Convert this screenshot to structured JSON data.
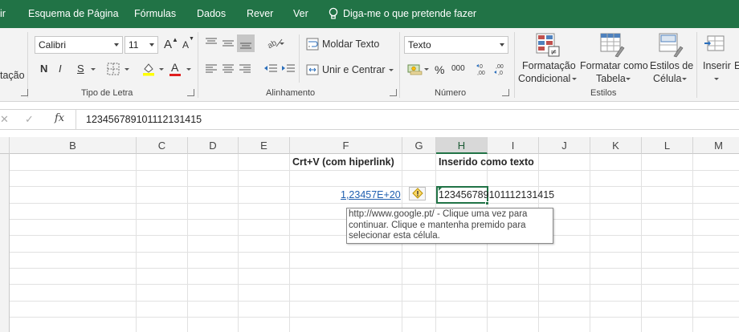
{
  "menu": {
    "items": [
      "ir",
      "Esquema de Página",
      "Fórmulas",
      "Dados",
      "Rever",
      "Ver"
    ],
    "tell_me": "Diga-me o que pretende fazer"
  },
  "ribbon": {
    "partial_left_label": "tação",
    "font_name": "Calibri",
    "font_size": "11",
    "grow_label": "A",
    "shrink_label": "A",
    "bold_label": "N",
    "italic_label": "I",
    "underline_label": "S",
    "font_color_label": "A",
    "font_group_label": "Tipo de Letra",
    "wrap_text_label": "Moldar Texto",
    "merge_center_label": "Unir e Centrar",
    "alignment_group_label": "Alinhamento",
    "number_format": "Texto",
    "percent_label": "%",
    "thousands_label": "000",
    "number_group_label": "Número",
    "conditional_format_line1": "Formatação",
    "conditional_format_line2": "Condicional",
    "format_table_line1": "Formatar como",
    "format_table_line2": "Tabela",
    "cell_styles_line1": "Estilos de",
    "cell_styles_line2": "Célula",
    "styles_group_label": "Estilos",
    "insert_label": "Inserir",
    "partial_right_label": "E"
  },
  "formula_bar": {
    "fx_label": "fx",
    "content": "123456789101112131415"
  },
  "columns": [
    "B",
    "C",
    "D",
    "E",
    "F",
    "G",
    "H",
    "I",
    "J",
    "K",
    "L",
    "M"
  ],
  "cells": {
    "f_header": "Crt+V (com hiperlink)",
    "h_header": "Inserido como texto",
    "f_value": "1,23457E+20",
    "h_value": "123456789101112131415"
  },
  "tooltip": {
    "line1": "http://www.google.pt/ - Clique uma vez para",
    "line2": "continuar. Clique e mantenha premido para",
    "line3": "selecionar esta célula."
  },
  "colors": {
    "accent": "#217346",
    "link": "#1f5fb0"
  }
}
